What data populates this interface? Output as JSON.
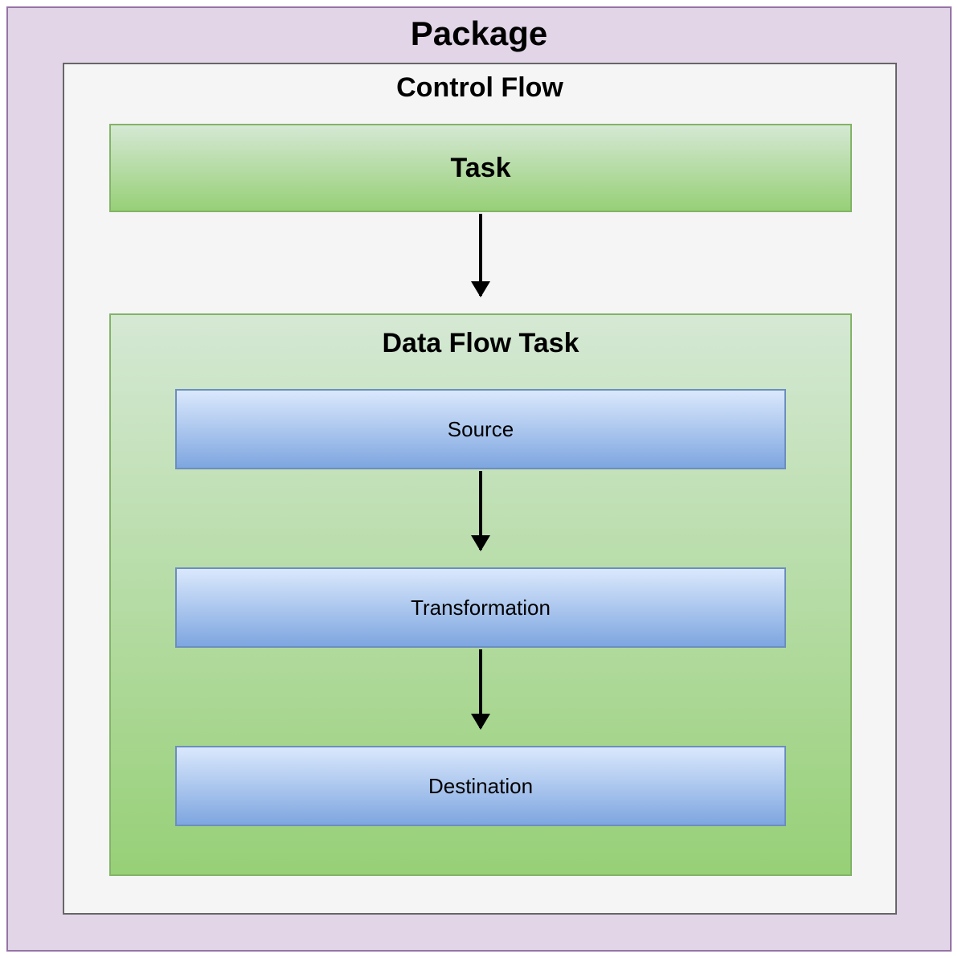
{
  "package": {
    "title": "Package"
  },
  "controlFlow": {
    "title": "Control Flow",
    "task": {
      "label": "Task"
    },
    "dataFlowTask": {
      "title": "Data Flow Task",
      "source": "Source",
      "transformation": "Transformation",
      "destination": "Destination"
    }
  }
}
